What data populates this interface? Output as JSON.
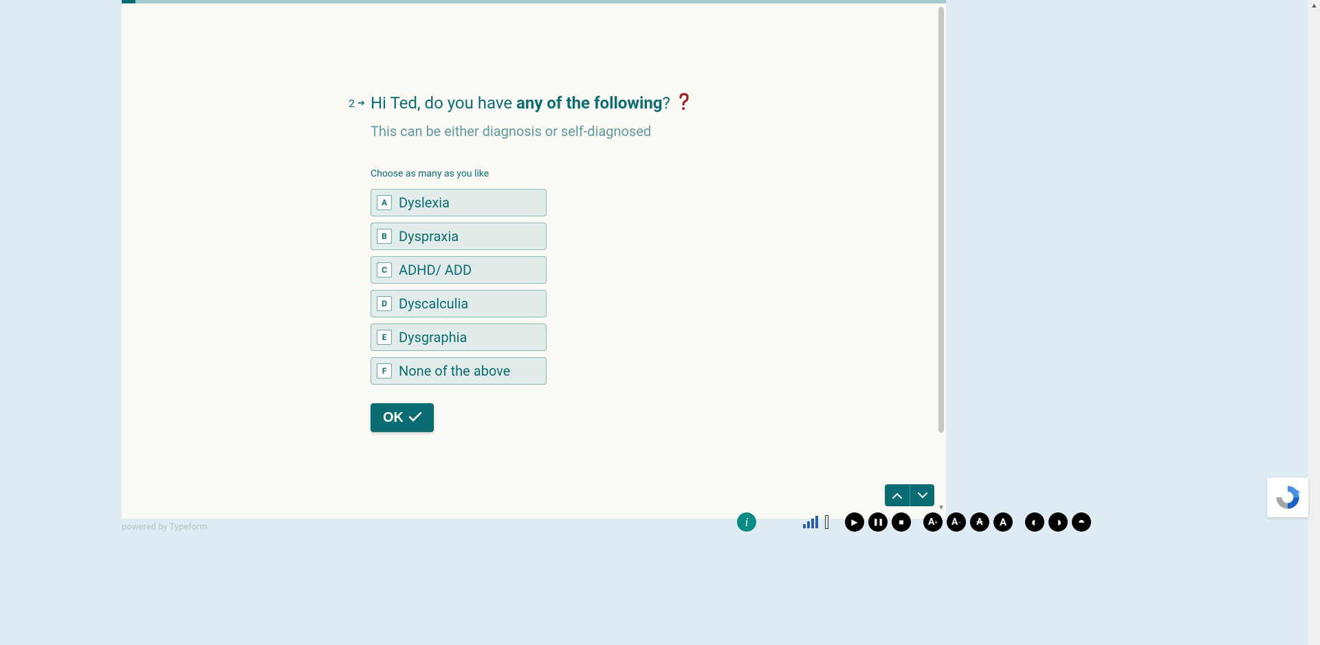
{
  "question": {
    "number": "2",
    "greeting_prefix": "Hi Ted, do you have ",
    "greeting_bold": "any of the following",
    "greeting_suffix": "? ",
    "subtext": "This can be either diagnosis or self-diagnosed",
    "hint": "Choose as many as you like",
    "options": [
      {
        "key": "A",
        "label": "Dyslexia"
      },
      {
        "key": "B",
        "label": "Dyspraxia"
      },
      {
        "key": "C",
        "label": "ADHD/ ADD"
      },
      {
        "key": "D",
        "label": "Dyscalculia"
      },
      {
        "key": "E",
        "label": "Dysgraphia"
      },
      {
        "key": "F",
        "label": "None of the above"
      }
    ],
    "ok_label": "OK"
  },
  "footer": {
    "powered_prefix": "powered by ",
    "powered_brand": "Typeform"
  },
  "toolbar": {
    "info": "i",
    "play": "▶",
    "pause": "❚❚",
    "stop": "■",
    "a_plus": "A",
    "a_minus": "A",
    "a_strike": "A",
    "a_plain": "A",
    "contrast1": "◐",
    "contrast2": "◑",
    "contrast3": "◓"
  }
}
